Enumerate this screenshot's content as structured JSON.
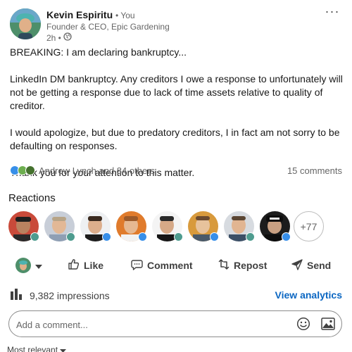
{
  "post": {
    "author": {
      "name": "Kevin Espiritu",
      "you_label": "• You",
      "headline": "Founder & CEO, Epic Gardening",
      "time": "2h •",
      "visibility_icon": "globe-icon"
    },
    "body": {
      "p1": "BREAKING: I am declaring bankruptcy...",
      "p2": "LinkedIn DM bankruptcy. Any creditors I owe a response to unfortunately will not be getting a response due to lack of time assets relative to quality of creditor.",
      "p3": "I would apologize, but due to predatory creditors, I in fact am not sorry to be defaulting on responses.",
      "p4": "Thank you for your attention to this matter."
    },
    "social": {
      "reactors": "Andrew Lynch and 84 others",
      "comments": "15 comments"
    }
  },
  "reactions": {
    "title": "Reactions",
    "more": "+77"
  },
  "actions": {
    "like": "Like",
    "comment": "Comment",
    "repost": "Repost",
    "send": "Send"
  },
  "analytics": {
    "impressions": "9,382 impressions",
    "link": "View analytics"
  },
  "comment_box": {
    "placeholder": "Add a comment..."
  },
  "sort": {
    "label": "Most relevant"
  },
  "colors": {
    "brand_blue": "#0a66c2",
    "like_blue": "#378fe9",
    "celebrate_green": "#44712e",
    "support_teal": "#6dae4f"
  }
}
